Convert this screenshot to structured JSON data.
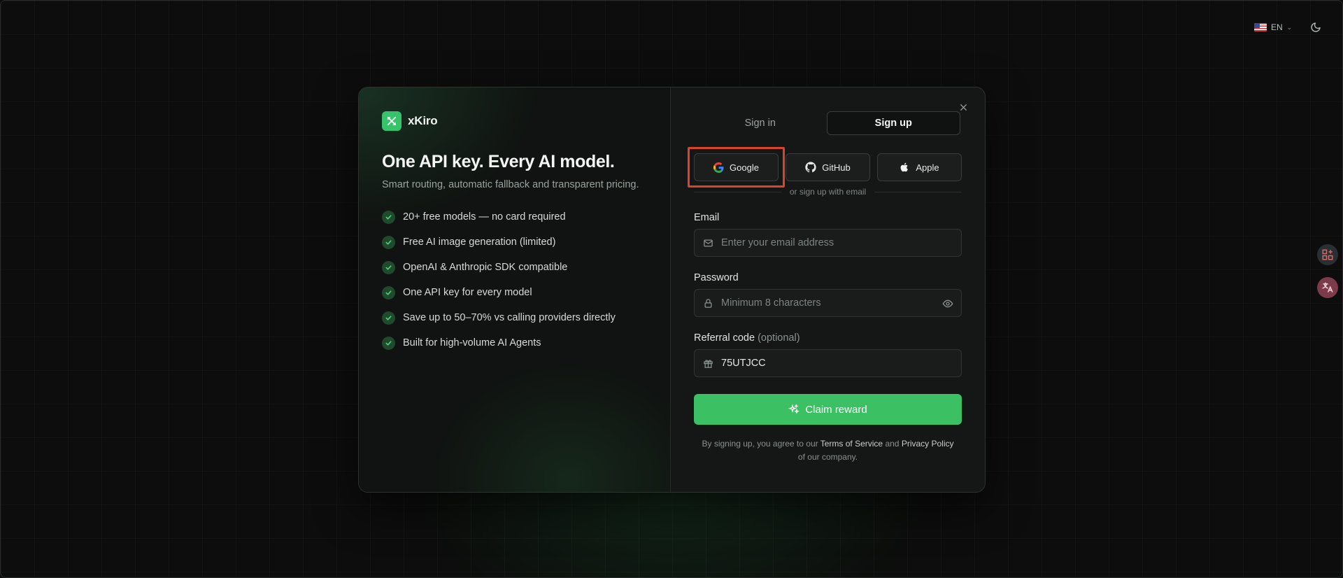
{
  "topbar": {
    "language": "EN",
    "theme_icon": "moon-icon"
  },
  "brand": {
    "name": "xKiro",
    "logo_icon": "xkiro-logo-icon"
  },
  "promo": {
    "headline": "One API key. Every AI model.",
    "subhead": "Smart routing, automatic fallback and transparent pricing.",
    "features": [
      "20+ free models — no card required",
      "Free AI image generation (limited)",
      "OpenAI & Anthropic SDK compatible",
      "One API key for every model",
      "Save up to 50–70% vs calling providers directly",
      "Built for high-volume AI Agents"
    ]
  },
  "auth": {
    "tabs": [
      {
        "label": "Sign in",
        "active": false
      },
      {
        "label": "Sign up",
        "active": true
      }
    ],
    "oauth": [
      {
        "label": "Google",
        "icon": "google-icon"
      },
      {
        "label": "GitHub",
        "icon": "github-icon"
      },
      {
        "label": "Apple",
        "icon": "apple-icon"
      }
    ],
    "divider_text": "or sign up with email",
    "email": {
      "label": "Email",
      "placeholder": "Enter your email address",
      "value": ""
    },
    "password": {
      "label": "Password",
      "placeholder": "Minimum 8 characters",
      "value": ""
    },
    "referral": {
      "label": "Referral code",
      "optional": "(optional)",
      "value": "75UTJCC"
    },
    "submit_label": "Claim reward",
    "terms": {
      "prefix": "By signing up, you agree to our",
      "tos": "Terms of Service",
      "and": "and",
      "privacy": "Privacy Policy",
      "suffix": "of our company."
    }
  },
  "colors": {
    "accent": "#3bc163",
    "highlight": "#d9452c"
  }
}
